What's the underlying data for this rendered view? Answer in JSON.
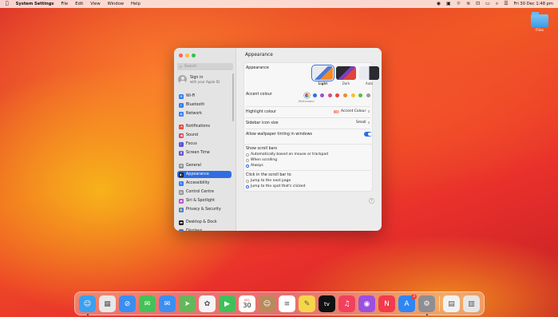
{
  "menubar": {
    "app_name": "System Settings",
    "menus": [
      "File",
      "Edit",
      "View",
      "Window",
      "Help"
    ],
    "clock": "Fri 30 Dec  1:48 pm",
    "icons": [
      "apple-icon",
      "record-icon",
      "camera-icon",
      "sun-icon",
      "wifi-icon",
      "lock-icon",
      "battery-icon",
      "search-icon",
      "control-center-icon"
    ]
  },
  "desktop": {
    "folder_label": "Files"
  },
  "window": {
    "search_placeholder": "Search",
    "signin": {
      "title": "Sign in",
      "subtitle": "with your Apple ID"
    },
    "sidebar_items": [
      {
        "label": "Wi-Fi",
        "icon": "wifi-icon",
        "color": "#2f7cf6"
      },
      {
        "label": "Bluetooth",
        "icon": "bluetooth-icon",
        "color": "#2f7cf6"
      },
      {
        "label": "Network",
        "icon": "globe-icon",
        "color": "#2f7cf6"
      },
      {
        "label": "Notifications",
        "icon": "bell-icon",
        "color": "#e94235"
      },
      {
        "label": "Sound",
        "icon": "speaker-icon",
        "color": "#e94260"
      },
      {
        "label": "Focus",
        "icon": "moon-icon",
        "color": "#5b4fd6"
      },
      {
        "label": "Screen Time",
        "icon": "hourglass-icon",
        "color": "#6a4fd6"
      },
      {
        "label": "General",
        "icon": "gear-icon",
        "color": "#8e8e93"
      },
      {
        "label": "Appearance",
        "icon": "appearance-icon",
        "color": "#1c1c1e"
      },
      {
        "label": "Accessibility",
        "icon": "accessibility-icon",
        "color": "#2f7cf6"
      },
      {
        "label": "Control Centre",
        "icon": "control-centre-icon",
        "color": "#8e8e93"
      },
      {
        "label": "Siri & Spotlight",
        "icon": "siri-icon",
        "color": "#c04bd6"
      },
      {
        "label": "Privacy & Security",
        "icon": "hand-icon",
        "color": "#2f7cf6"
      },
      {
        "label": "Desktop & Dock",
        "icon": "dock-icon",
        "color": "#1c1c1e"
      },
      {
        "label": "Displays",
        "icon": "display-icon",
        "color": "#2f7cf6"
      }
    ],
    "selected_item": "Appearance",
    "main": {
      "title": "Appearance",
      "appearance_label": "Appearance",
      "modes": [
        {
          "label": "Light",
          "selected": true
        },
        {
          "label": "Dark",
          "selected": false
        },
        {
          "label": "Auto",
          "selected": false
        }
      ],
      "accent_label": "Accent colour",
      "accent_colors": [
        "#c9c9c9",
        "#2f6de1",
        "#9b4fd6",
        "#e2458d",
        "#e8453c",
        "#f08a24",
        "#f5c12b",
        "#5fb843",
        "#9a9a9a"
      ],
      "accent_selected_caption": "Multicolour",
      "highlight_label": "Highlight colour",
      "highlight_value": "Accent Colour",
      "icon_size_label": "Sidebar icon size",
      "icon_size_value": "Small",
      "tinting_label": "Allow wallpaper tinting in windows",
      "tinting_on": true,
      "scroll_title": "Show scroll bars",
      "scroll_options": [
        "Automatically based on mouse or trackpad",
        "When scrolling",
        "Always"
      ],
      "scroll_selected": "Always",
      "click_title": "Click in the scroll bar to",
      "click_options": [
        "Jump to the next page",
        "Jump to the spot that's clicked"
      ],
      "click_selected": "Jump to the spot that's clicked",
      "help": "?"
    }
  },
  "dock": {
    "apps": [
      {
        "name": "finder-icon",
        "color": "#3aa0f0",
        "glyph": "☺"
      },
      {
        "name": "launchpad-icon",
        "color": "#e8e8e8",
        "glyph": "▦"
      },
      {
        "name": "safari-icon",
        "color": "#3a8ef0",
        "glyph": "⊘"
      },
      {
        "name": "messages-icon",
        "color": "#43c25a",
        "glyph": "✉"
      },
      {
        "name": "mail-icon",
        "color": "#3b8ff3",
        "glyph": "✉"
      },
      {
        "name": "maps-icon",
        "color": "#62b85a",
        "glyph": "➤"
      },
      {
        "name": "photos-icon",
        "color": "#f4f4f4",
        "glyph": "✿"
      },
      {
        "name": "facetime-icon",
        "color": "#3fc05a",
        "glyph": "▶"
      },
      {
        "name": "calendar-icon",
        "color": "#ffffff",
        "glyph": "30"
      },
      {
        "name": "contacts-icon",
        "color": "#b98a5c",
        "glyph": "☺"
      },
      {
        "name": "reminders-icon",
        "color": "#ffffff",
        "glyph": "≡"
      },
      {
        "name": "notes-icon",
        "color": "#f7d54a",
        "glyph": "✎"
      },
      {
        "name": "tv-icon",
        "color": "#111111",
        "glyph": "tv"
      },
      {
        "name": "music-icon",
        "color": "#f2405e",
        "glyph": "♫"
      },
      {
        "name": "podcasts-icon",
        "color": "#9c4fe0",
        "glyph": "◉"
      },
      {
        "name": "news-icon",
        "color": "#f23b4c",
        "glyph": "N"
      },
      {
        "name": "app-store-icon",
        "color": "#2f86f2",
        "glyph": "A"
      },
      {
        "name": "system-settings-icon",
        "color": "#8e8e93",
        "glyph": "⚙"
      },
      {
        "name": "preview-icon",
        "color": "#f2f2f2",
        "glyph": "▤"
      },
      {
        "name": "trash-icon",
        "color": "#e6e6e6",
        "glyph": "▥"
      }
    ],
    "calendar_month": "DEC",
    "calendar_day": "30",
    "app_store_badge": "3"
  }
}
